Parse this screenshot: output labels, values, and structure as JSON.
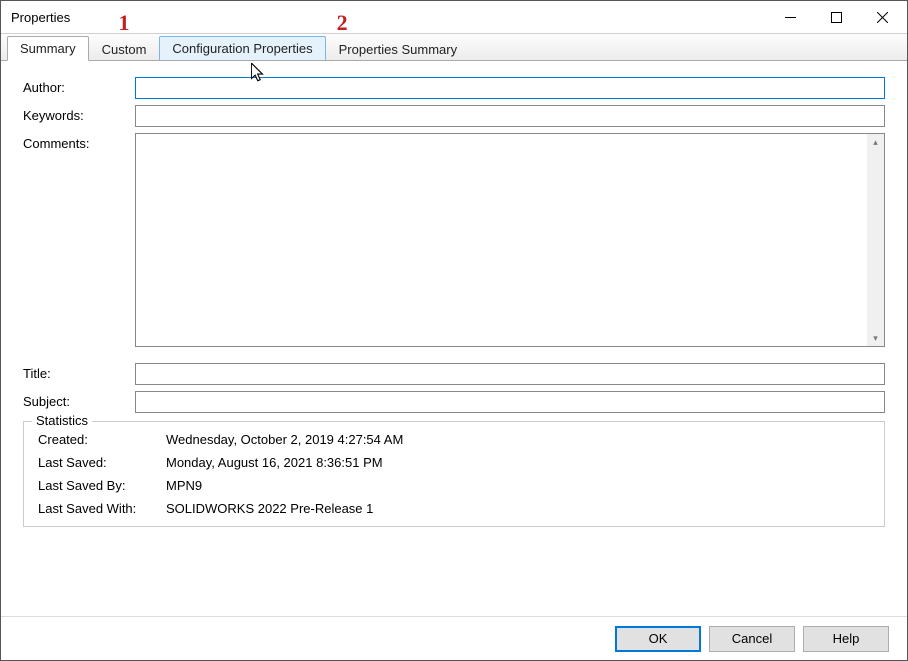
{
  "window": {
    "title": "Properties"
  },
  "tabs": [
    {
      "label": "Summary"
    },
    {
      "label": "Custom"
    },
    {
      "label": "Configuration Properties"
    },
    {
      "label": "Properties Summary"
    }
  ],
  "annotations": {
    "one": "1",
    "two": "2"
  },
  "fields": {
    "author": {
      "label": "Author:",
      "value": ""
    },
    "keywords": {
      "label": "Keywords:",
      "value": ""
    },
    "comments": {
      "label": "Comments:",
      "value": ""
    },
    "title": {
      "label": "Title:",
      "value": ""
    },
    "subject": {
      "label": "Subject:",
      "value": ""
    }
  },
  "statistics": {
    "legend": "Statistics",
    "created": {
      "label": "Created:",
      "value": "Wednesday, October 2, 2019 4:27:54 AM"
    },
    "lastSaved": {
      "label": "Last Saved:",
      "value": "Monday, August 16, 2021 8:36:51 PM"
    },
    "lastSavedBy": {
      "label": "Last Saved By:",
      "value": "MPN9"
    },
    "lastSavedWith": {
      "label": "Last Saved With:",
      "value": "SOLIDWORKS 2022 Pre-Release 1"
    }
  },
  "buttons": {
    "ok": "OK",
    "cancel": "Cancel",
    "help": "Help"
  }
}
